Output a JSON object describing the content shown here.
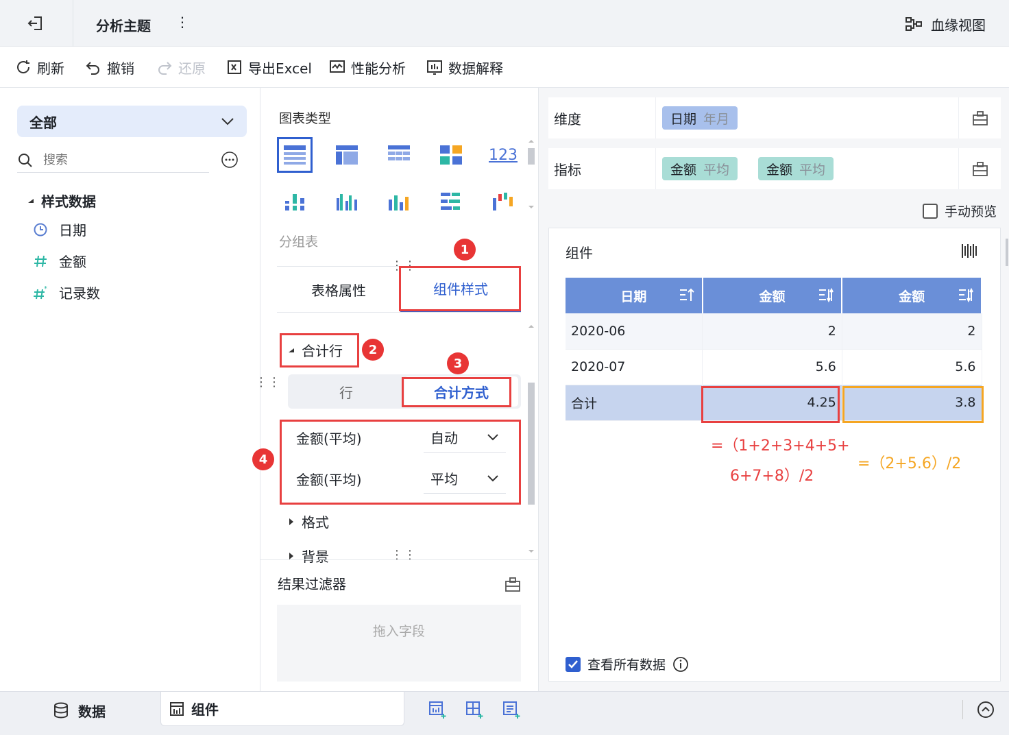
{
  "topbar": {
    "title": "分析主题",
    "more": "⋮",
    "lineage": "血缘视图"
  },
  "toolbar": {
    "refresh": "刷新",
    "undo": "撤销",
    "redo": "还原",
    "export": "导出Excel",
    "perf": "性能分析",
    "explain": "数据解释"
  },
  "left": {
    "scope": "全部",
    "search_placeholder": "搜索",
    "tree_root": "样式数据",
    "fields": [
      {
        "name": "日期",
        "icon": "clock-icon"
      },
      {
        "name": "金额",
        "icon": "hash-icon"
      },
      {
        "name": "记录数",
        "icon": "hash-star-icon"
      }
    ]
  },
  "middle": {
    "chart_type_title": "图表类型",
    "chart_type_name": "分组表",
    "tabs": {
      "table_props": "表格属性",
      "comp_style": "组件样式"
    },
    "sum_section": "合计行",
    "seg": {
      "row": "行",
      "sum_mode": "合计方式"
    },
    "sum_rows": [
      {
        "label": "金额(平均)",
        "value": "自动"
      },
      {
        "label": "金额(平均)",
        "value": "平均"
      }
    ],
    "format": "格式",
    "background": "背景",
    "filter_title": "结果过滤器",
    "drop_hint": "拖入字段",
    "badges": [
      "1",
      "2",
      "3",
      "4"
    ],
    "number_icon_text": "123"
  },
  "right": {
    "dimension_label": "维度",
    "metric_label": "指标",
    "dim_chip": {
      "name": "日期",
      "sub": "年月"
    },
    "metric_chips": [
      {
        "name": "金额",
        "sub": "平均"
      },
      {
        "name": "金额",
        "sub": "平均"
      }
    ],
    "manual_preview": "手动预览",
    "component_title": "组件",
    "table": {
      "headers": [
        "日期",
        "金额",
        "金额"
      ],
      "rows": [
        [
          "2020-06",
          "2",
          "2"
        ],
        [
          "2020-07",
          "5.6",
          "5.6"
        ]
      ],
      "total": [
        "合计",
        "4.25",
        "3.8"
      ]
    },
    "formula_red_1": "=（1+2+3+4+5+",
    "formula_red_2": "6+7+8）/2",
    "formula_orange": "=（2+5.6）/2",
    "view_all": "查看所有数据"
  },
  "bottom": {
    "data_tab": "数据",
    "comp_tab": "组件"
  },
  "colors": {
    "accent": "#2f5fcf",
    "header": "#6a8fd8",
    "annot_red": "#e84040",
    "annot_orange": "#f5a623"
  }
}
